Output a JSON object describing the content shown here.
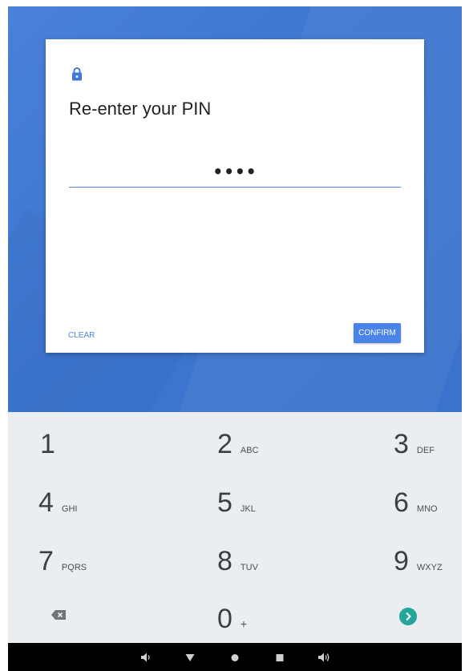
{
  "dialog": {
    "title": "Re-enter your PIN",
    "pin_value": "••••",
    "clear_label": "CLEAR",
    "confirm_label": "CONFIRM"
  },
  "keypad": {
    "keys": [
      {
        "digit": "1",
        "letters": ""
      },
      {
        "digit": "2",
        "letters": "ABC"
      },
      {
        "digit": "3",
        "letters": "DEF"
      },
      {
        "digit": "4",
        "letters": "GHI"
      },
      {
        "digit": "5",
        "letters": "JKL"
      },
      {
        "digit": "6",
        "letters": "MNO"
      },
      {
        "digit": "7",
        "letters": "PQRS"
      },
      {
        "digit": "8",
        "letters": "TUV"
      },
      {
        "digit": "9",
        "letters": "WXYZ"
      },
      {
        "digit": "0",
        "letters": "+"
      }
    ],
    "backspace_icon": "backspace-icon",
    "enter_icon": "enter-arrow-icon"
  },
  "navbar": {
    "icons": [
      "volume-down-icon",
      "back-triangle-icon",
      "home-circle-icon",
      "recents-square-icon",
      "volume-up-icon"
    ]
  },
  "colors": {
    "background_blue": "#3b74cf",
    "accent_blue": "#4a84e8",
    "keypad_bg": "#ebeef1",
    "enter_teal": "#26a69a"
  }
}
